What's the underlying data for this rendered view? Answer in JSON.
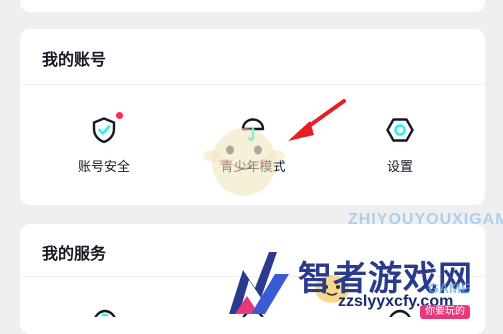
{
  "account_section": {
    "title": "我的账号",
    "items": [
      {
        "label": "账号安全",
        "icon": "shield-check-icon",
        "has_red_dot": true
      },
      {
        "label": "青少年模式",
        "icon": "umbrella-icon",
        "has_red_dot": false
      },
      {
        "label": "设置",
        "icon": "hexagon-settings-icon",
        "has_red_dot": false
      }
    ]
  },
  "services_section": {
    "title": "我的服务"
  },
  "watermark": {
    "title": "智者游戏网",
    "url": "zzslyyxcfy.com",
    "faint_text": "ZHIYOUYOUXIGAME",
    "game_text": "GAME",
    "badge_text": "你要玩的"
  },
  "colors": {
    "accent_cyan": "#25f4ee",
    "red_dot": "#fe2c55",
    "page_bg": "#efeff1",
    "card_bg": "#ffffff",
    "text": "#161823"
  }
}
